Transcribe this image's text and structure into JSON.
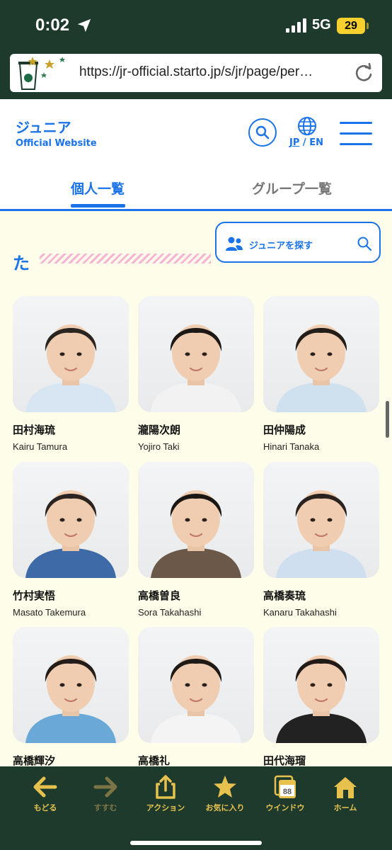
{
  "status": {
    "time": "0:02",
    "network": "5G",
    "battery": "29"
  },
  "browser": {
    "url": "https://jr-official.starto.jp/s/jr/page/per…"
  },
  "header": {
    "brand": "ジュニア",
    "subtitle": "Official Website",
    "lang_jp": "JP",
    "lang_sep": "/",
    "lang_en": "EN"
  },
  "tabs": [
    {
      "label": "個人一覧"
    },
    {
      "label": "グループ一覧"
    }
  ],
  "finder": {
    "label": "ジュニアを探す"
  },
  "section": {
    "char": "た"
  },
  "members": [
    {
      "jp": "田村海琉",
      "en": "Kairu Tamura"
    },
    {
      "jp": "瀧陽次朗",
      "en": "Yojiro Taki"
    },
    {
      "jp": "田仲陽成",
      "en": "Hinari Tanaka"
    },
    {
      "jp": "竹村実悟",
      "en": "Masato Takemura"
    },
    {
      "jp": "高橋曽良",
      "en": "Sora Takahashi"
    },
    {
      "jp": "高橋奏琉",
      "en": "Kanaru Takahashi"
    },
    {
      "jp": "高橋輝汐",
      "en": ""
    },
    {
      "jp": "高橋礼",
      "en": ""
    },
    {
      "jp": "田代海瑠",
      "en": ""
    }
  ],
  "toolbar": [
    {
      "label": "もどる",
      "icon": "arrow-left-icon"
    },
    {
      "label": "すすむ",
      "icon": "arrow-right-icon"
    },
    {
      "label": "アクション",
      "icon": "share-icon"
    },
    {
      "label": "お気に入り",
      "icon": "star-icon"
    },
    {
      "label": "ウインドウ",
      "icon": "windows-icon",
      "count": "88"
    },
    {
      "label": "ホーム",
      "icon": "home-icon"
    }
  ],
  "colors": {
    "accent": "#1a73e8",
    "browser_chrome": "#1d3a2c",
    "toolbar_icon": "#e7c14e",
    "background": "#fdfde9"
  }
}
